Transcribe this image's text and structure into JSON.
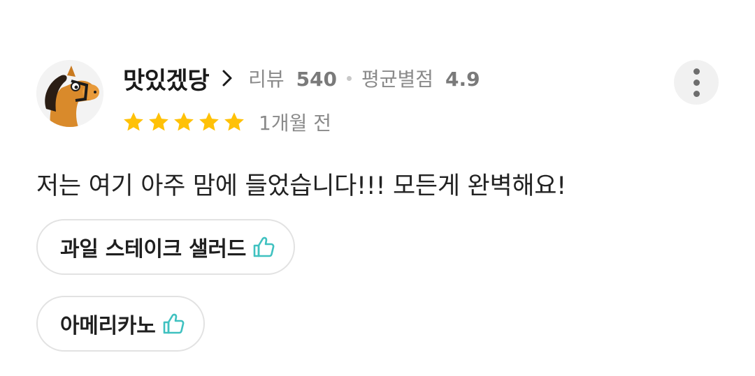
{
  "user": {
    "nickname": "맛있겠당",
    "review_count_label": "리뷰",
    "review_count": "540",
    "avg_rating_label": "평균별점",
    "avg_rating": "4.9",
    "avatar_icon": "horse-avatar-icon"
  },
  "rating": {
    "stars": 5,
    "star_color": "#FFC107",
    "time_ago": "1개월 전"
  },
  "review": {
    "text": "저는 여기 아주 맘에 들었습니다!!! 모든게 완벽해요!"
  },
  "menu_tags": [
    {
      "label": "과일 스테이크 샐러드",
      "icon": "thumbs-up-icon"
    },
    {
      "label": "아메리카노",
      "icon": "thumbs-up-icon"
    }
  ],
  "colors": {
    "accent_thumb": "#3FC1C0",
    "chip_border": "#E2E2E2"
  }
}
